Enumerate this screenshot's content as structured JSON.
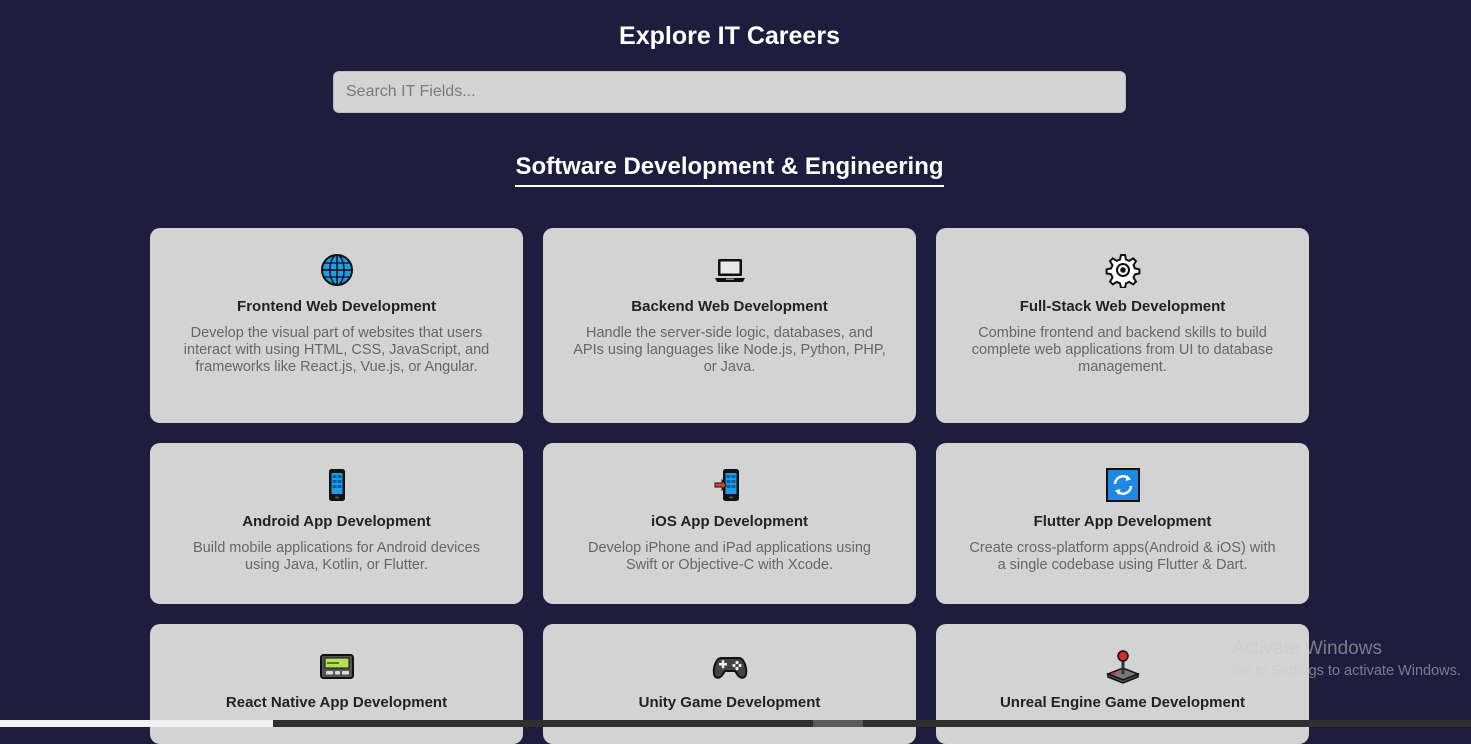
{
  "header": {
    "title": "Explore IT Careers"
  },
  "search": {
    "placeholder": "Search IT Fields..."
  },
  "section": {
    "heading": "Software Development & Engineering"
  },
  "cards": [
    {
      "icon": "globe-icon",
      "title": "Frontend Web Development",
      "description": "Develop the visual part of websites that users interact with using HTML, CSS, JavaScript, and frameworks like React.js, Vue.js, or Angular."
    },
    {
      "icon": "laptop-icon",
      "title": "Backend Web Development",
      "description": "Handle the server-side logic, databases, and APIs using languages like Node.js, Python, PHP, or Java."
    },
    {
      "icon": "gear-icon",
      "title": "Full-Stack Web Development",
      "description": "Combine frontend and backend skills to build complete web applications from UI to database management."
    },
    {
      "icon": "mobile-phone-icon",
      "title": "Android App Development",
      "description": "Build mobile applications for Android devices using Java, Kotlin, or Flutter."
    },
    {
      "icon": "mobile-phone-arrow-icon",
      "title": "iOS App Development",
      "description": "Develop iPhone and iPad applications using Swift or Objective-C with Xcode."
    },
    {
      "icon": "refresh-icon",
      "title": "Flutter App Development",
      "description": "Create cross-platform apps(Android & iOS) with a single codebase using Flutter & Dart."
    },
    {
      "icon": "pager-icon",
      "title": "React Native App Development",
      "description": ""
    },
    {
      "icon": "game-controller-icon",
      "title": "Unity Game Development",
      "description": ""
    },
    {
      "icon": "joystick-icon",
      "title": "Unreal Engine Game Development",
      "description": ""
    }
  ],
  "watermark": {
    "line1": "Activate Windows",
    "line2": "Go to Settings to activate Windows."
  },
  "colors": {
    "background": "#1e1d3d",
    "card": "#d3d3d3",
    "accent_blue": "#1e88e5"
  }
}
